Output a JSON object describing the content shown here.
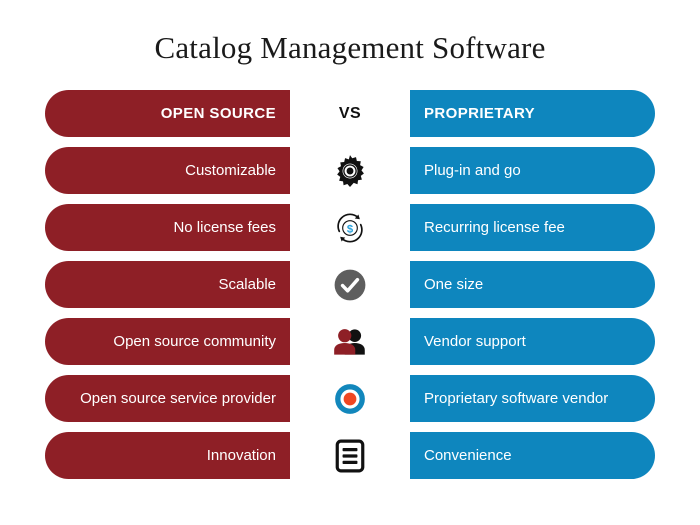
{
  "title": "Catalog Management Software",
  "colors": {
    "left_bar": "#8e1f26",
    "right_bar": "#0e86be",
    "text_on_bar": "#ffffff",
    "title": "#1a1a1a",
    "vs_text": "#111111",
    "check_circle": "#5e5e5e",
    "dollar_accent": "#27a0db",
    "target_ring": "#1287bc",
    "target_center": "#ef4723",
    "user_front": "#8e1f26",
    "user_back": "#111111"
  },
  "header": {
    "left_label": "OPEN SOURCE",
    "center_label": "VS",
    "right_label": "PROPRIETARY"
  },
  "rows": [
    {
      "left": "Customizable",
      "icon": "gear-icon",
      "right": "Plug-in and go"
    },
    {
      "left": "No license fees",
      "icon": "recurring-dollar-icon",
      "right": "Recurring license fee"
    },
    {
      "left": "Scalable",
      "icon": "check-circle-icon",
      "right": "One size"
    },
    {
      "left": "Open source community",
      "icon": "users-icon",
      "right": "Vendor support"
    },
    {
      "left": "Open source service provider",
      "icon": "target-icon",
      "right": "Proprietary software vendor"
    },
    {
      "left": "Innovation",
      "icon": "document-list-icon",
      "right": "Convenience"
    }
  ]
}
